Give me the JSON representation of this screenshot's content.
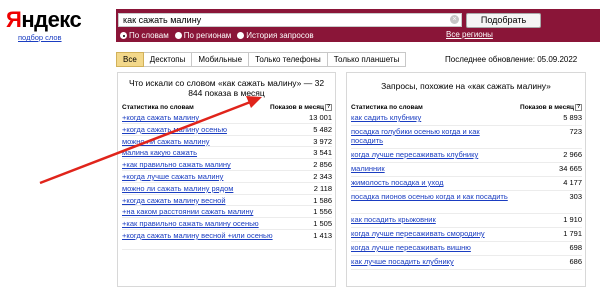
{
  "header": {
    "logo_first": "Я",
    "logo_rest": "ндекс",
    "sublink": "подбор слов"
  },
  "search": {
    "value": "как сажать малину",
    "button": "Подобрать",
    "radios": [
      {
        "label": "По словам",
        "selected": true
      },
      {
        "label": "По регионам",
        "selected": false
      },
      {
        "label": "История запросов",
        "selected": false
      }
    ],
    "regions_link": "Все регионы"
  },
  "tabs": [
    {
      "label": "Все",
      "active": true
    },
    {
      "label": "Десктопы",
      "active": false
    },
    {
      "label": "Мобильные",
      "active": false
    },
    {
      "label": "Только телефоны",
      "active": false
    },
    {
      "label": "Только планшеты",
      "active": false
    }
  ],
  "updated": "Последнее обновление: 05.09.2022",
  "left_panel": {
    "title": "Что искали со словом «как сажать малину» — 32 844 показа в месяц",
    "col_kw": "Статистика по словам",
    "col_count": "Показов в месяц",
    "rows": [
      {
        "kw": "+когда сажать малину",
        "count": "13 001"
      },
      {
        "kw": "+когда сажать малину осенью",
        "count": "5 482"
      },
      {
        "kw": "можно ли сажать малину",
        "count": "3 972"
      },
      {
        "kw": "малина какую сажать",
        "count": "3 541"
      },
      {
        "kw": "+как правильно сажать малину",
        "count": "2 856"
      },
      {
        "kw": "+когда лучше сажать малину",
        "count": "2 343"
      },
      {
        "kw": "можно ли сажать малину рядом",
        "count": "2 118"
      },
      {
        "kw": "+когда сажать малину весной",
        "count": "1 586"
      },
      {
        "kw": "+на каком расстоянии сажать малину",
        "count": "1 556"
      },
      {
        "kw": "+как правильно сажать малину осенью",
        "count": "1 505"
      },
      {
        "kw": "+когда сажать малину весной +или осенью",
        "count": "1 413"
      }
    ]
  },
  "right_panel": {
    "title": "Запросы, похожие на «как сажать малину»",
    "col_kw": "Статистика по словам",
    "col_count": "Показов в месяц",
    "rows": [
      {
        "kw": "как садить клубнику",
        "count": "5 893"
      },
      {
        "kw": "посадка голубики осенью когда и как посадить",
        "count": "723"
      },
      {
        "kw": "когда лучше пересаживать клубнику",
        "count": "2 966"
      },
      {
        "kw": "малинник",
        "count": "34 665"
      },
      {
        "kw": "жимолость посадка и уход",
        "count": "4 177"
      },
      {
        "kw": "посадка пионов осенью когда и как посадить",
        "count": "303"
      },
      {
        "kw": "как посадить крыжовник",
        "count": "1 910"
      },
      {
        "kw": "когда лучше пересаживать смородину",
        "count": "1 791"
      },
      {
        "kw": "когда лучше пересаживать вишню",
        "count": "698"
      },
      {
        "kw": "как лучше посадить клубнику",
        "count": "686"
      }
    ]
  },
  "colors": {
    "brand_red": "#e00",
    "search_bar": "#8a1538",
    "active_tab": "#f3d88a",
    "link": "#1a3dc1",
    "arrow": "#e0241b"
  }
}
